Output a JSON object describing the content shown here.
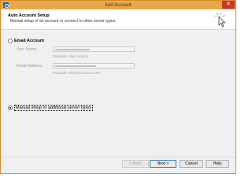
{
  "window": {
    "title": "Add Account",
    "close_glyph": "✕"
  },
  "header": {
    "title": "Auto Account Setup",
    "subtitle": "Manual setup of an account or connect to other server types."
  },
  "options": {
    "email_account_label": "Email Account",
    "manual_setup_label": "Manual setup or additional server types",
    "selected": "manual_setup"
  },
  "fields": {
    "name_label": "Your Name:",
    "name_example": "Example: Ellen Adams",
    "email_label": "Email Address:",
    "email_example": "Example: ellen@contoso.com"
  },
  "buttons": {
    "back": "< Back",
    "next": "Next >",
    "cancel": "Cancel",
    "help": "Help"
  },
  "colors": {
    "titlebar": "#e8a84a",
    "close": "#c7382b",
    "default_button_border": "#3c7fb1"
  },
  "icons": {
    "app": "outlook-icon",
    "header": "cursor-click-icon"
  }
}
